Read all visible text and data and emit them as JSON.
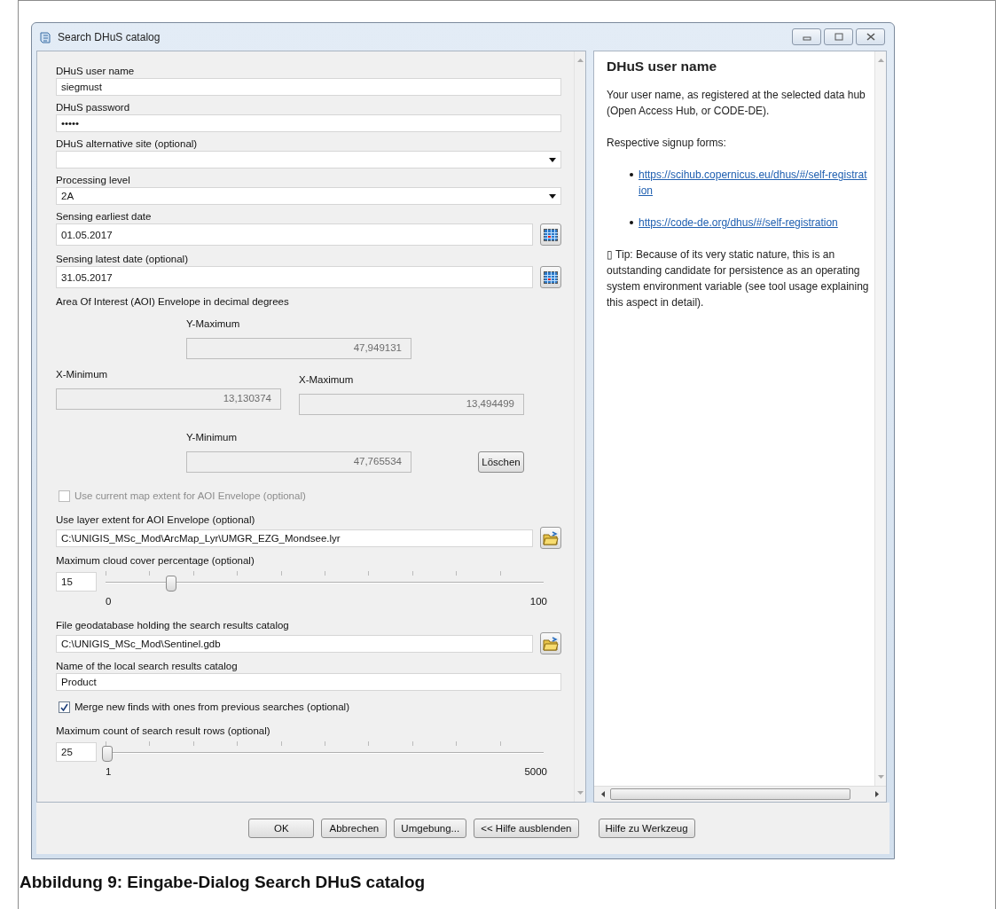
{
  "window": {
    "title": "Search DHuS catalog"
  },
  "form": [
    {
      "kind": "text",
      "label": "DHuS user name",
      "value": "siegmust"
    },
    {
      "kind": "password",
      "label": "DHuS password",
      "value": "•••••"
    },
    {
      "kind": "dropdown",
      "label": "DHuS alternative site (optional)"
    },
    {
      "kind": "dropdown",
      "label": "Processing level",
      "value": "2A"
    },
    {
      "kind": "date",
      "label": "Sensing earliest date",
      "value": "01.05.2017"
    },
    {
      "kind": "date",
      "label": "Sensing latest date (optional)",
      "value": "31.05.2017"
    },
    {
      "kind": "envelope",
      "label": "Area Of Interest (AOI) Envelope in decimal degrees",
      "y_max": {
        "label": "Y-Maximum",
        "value": "47,949131"
      },
      "x_min": {
        "label": "X-Minimum",
        "value": "13,130374"
      },
      "x_max": {
        "label": "X-Maximum",
        "value": "13,494499"
      },
      "y_min": {
        "label": "Y-Minimum",
        "value": "47,765534"
      },
      "clear_button": "Löschen"
    },
    {
      "kind": "checkbox",
      "label": "Use current map extent for AOI Envelope (optional)",
      "checked": false,
      "disabled": true
    },
    {
      "kind": "file",
      "label": "Use layer extent for AOI Envelope (optional)",
      "value": "C:\\UNIGIS_MSc_Mod\\ArcMap_Lyr\\UMGR_EZG_Mondsee.lyr"
    },
    {
      "kind": "slider",
      "label": "Maximum cloud cover percentage (optional)",
      "value": "15",
      "level": 0.15,
      "min_label": "0",
      "max_label": "100"
    },
    {
      "kind": "file",
      "label": "File geodatabase holding the search results catalog",
      "value": "C:\\UNIGIS_MSc_Mod\\Sentinel.gdb"
    },
    {
      "kind": "text",
      "label": "Name of the local search results catalog",
      "value": "Product"
    },
    {
      "kind": "checkbox",
      "label": "Merge new finds with ones from previous searches (optional)",
      "checked": true,
      "disabled": false
    },
    {
      "kind": "slider",
      "label": "Maximum count of search result rows (optional)",
      "value": "25",
      "level": 0.005,
      "min_label": "1",
      "max_label": "5000"
    }
  ],
  "help": {
    "title": "DHuS user name",
    "intro": "Your user name, as registered at the selected data hub (Open Access Hub, or CODE-DE).",
    "signup_heading": "Respective signup forms:",
    "links": [
      "https://scihub.copernicus.eu/dhus/#/self-registration",
      "https://code-de.org/dhus/#/self-registration"
    ],
    "tip": "▯ Tip: Because of its very static nature, this is an outstanding candidate for persistence as an operating system environment variable (see tool usage explaining this aspect in detail)."
  },
  "buttons": [
    {
      "label": "OK"
    },
    {
      "label": "Abbrechen"
    },
    {
      "label": "Umgebung..."
    },
    {
      "label": "<< Hilfe ausblenden"
    },
    {
      "label": "Hilfe zu Werkzeug"
    }
  ],
  "caption": "Abbildung 9: Eingabe-Dialog Search DHuS catalog"
}
